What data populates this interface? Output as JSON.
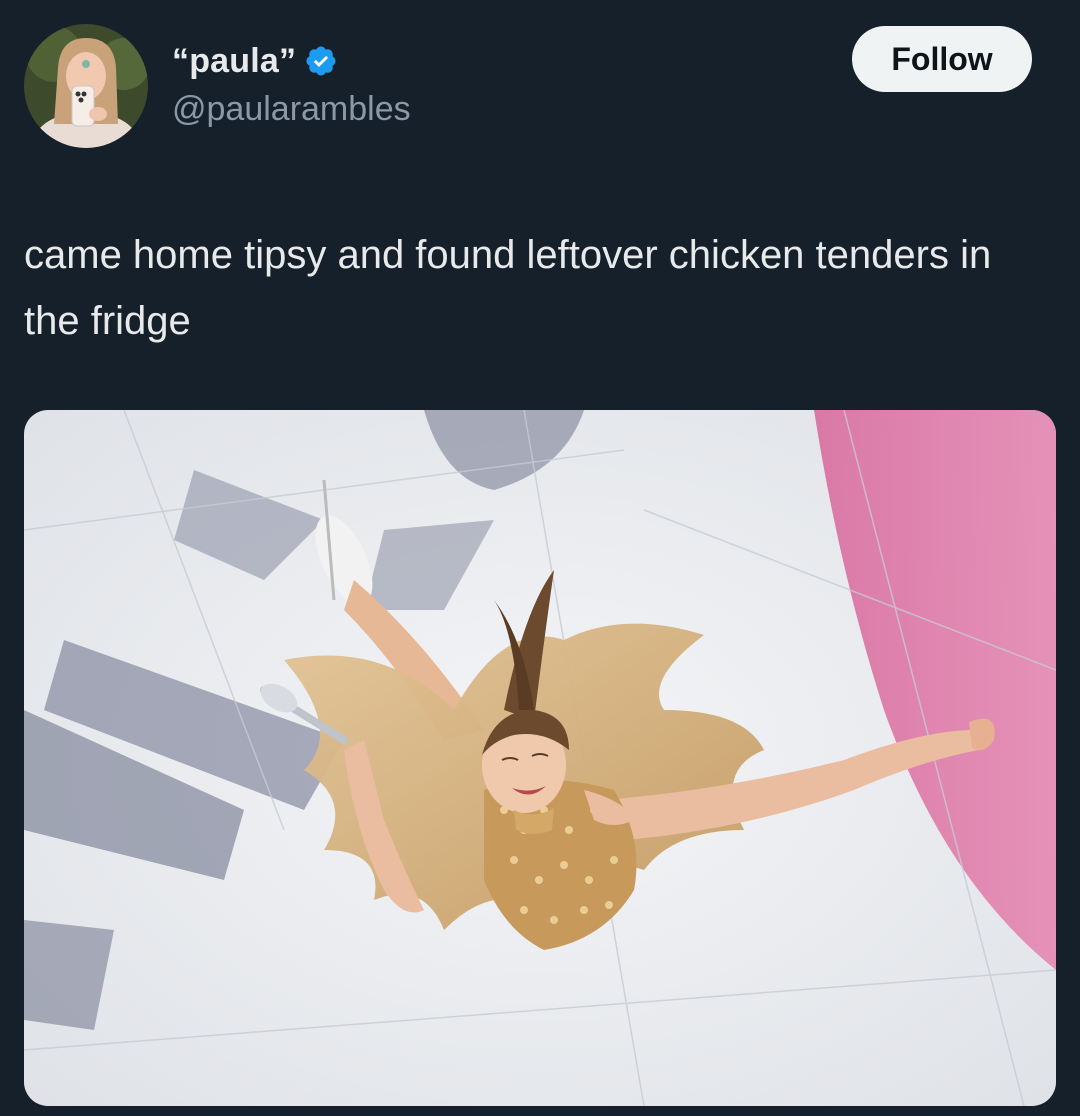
{
  "author": {
    "display_name": "“paula”",
    "handle": "@paularambles",
    "verified": true,
    "avatar_icon": "profile-photo"
  },
  "follow_button": {
    "label": "Follow"
  },
  "tweet": {
    "text": "came home tipsy and found leftover chicken tenders in the fridge"
  },
  "media": {
    "icon": "photo-figure-skater-lying-on-ice"
  },
  "colors": {
    "background": "#15202b",
    "primary_text": "#e7e9ea",
    "secondary_text": "#8b98a5",
    "verified_blue": "#1d9bf0",
    "follow_button_bg": "#eff3f4"
  }
}
